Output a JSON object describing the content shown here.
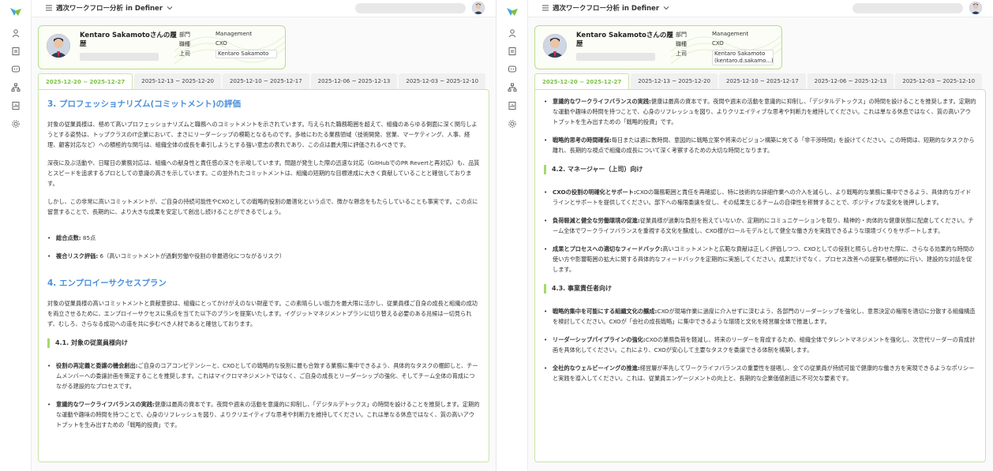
{
  "app": {
    "workflow_title": "週次ワークフロー分析 in Definer",
    "nav_icons": [
      "person-icon",
      "document-icon",
      "chat-icon",
      "org-chart-icon",
      "report-icon",
      "gear-icon"
    ]
  },
  "colors": {
    "accent": "#7cc044",
    "heading": "#4a90d9",
    "border": "#c8e6a6"
  },
  "profile": {
    "title": "Kentaro Sakamotoさんの履歴",
    "dept_label": "部門",
    "dept_value": "Management",
    "role_label": "職種",
    "role_value": "CXO",
    "boss_label": "上司",
    "boss_value_left": "Kentaro Sakamoto",
    "boss_value_right": "Kentaro Sakamoto (kentaro.d.sakamo...)"
  },
  "tabs": [
    "2025-12-20 ~ 2025-12-27",
    "2025-12-13 ~ 2025-12-20",
    "2025-12-10 ~ 2025-12-17",
    "2025-12-06 ~ 2025-12-13",
    "2025-12-03 ~ 2025-12-10"
  ],
  "left": {
    "h_professional": "3. プロフェッショナリズム(コミットメント)の評価",
    "p1": "対象の従業員様は、極めて高いプロフェッショナリズムと職務へのコミットメントを示されています。与えられた職務範囲を超えて、組織のあらゆる側面に深く関与しようとする姿勢は、トップクラスのIT企業において、まさにリーダーシップの模範となるものです。多岐にわたる業務領域（技術開発、営業、マーケティング、人事、経理、顧客対応など）への積極的な関与は、組織全体の成長を牽引しようとする強い意志の表れであり、この点は最大限に評価されるべきです。",
    "p2": "深夜に及ぶ活動や、日曜日の業務対応は、組織への献身性と責任感の深さを示唆しています。問題が発生した際の迅速な対応（GitHubでのPR Revertと再対応）も、品質とスピードを追求するプロとしての意識の高さを示しています。この並外れたコミットメントは、組織の短期的な目標達成に大きく貢献していることと確信しております。",
    "p3": "しかし、この非常に高いコミットメントが、ご自身の持続可能性やCXOとしての戦略的役割の最適化という点で、微かな懸念をもたらしていることも事実です。この点に留意することで、長期的に、より大きな成果を安定して創出し続けることができるでしょう。",
    "score_label": "総合点数:",
    "score_value": "85点",
    "risk_label": "複合リスク評価:",
    "risk_value": "6（高いコミットメントが過剰労働や役割の非最適化につながるリスク）",
    "h_plan": "4. エンプロイーサクセスプラン",
    "p4": "対象の従業員様の高いコミットメントと貢献意欲は、組織にとってかけがえのない財産です。この素晴らしい能力を最大限に活かし、従業員様ご自身の成長と組織の成功を両立させるために、エンプロイーサクセスに焦点を当てた以下のプランを提案いたします。イグジットマネジメントプランに切り替える必要のある兆候は一切見られず、むしろ、さらなる成功への道を共に歩むべき人材であると確信しております。",
    "h_41": "4.1. 対象の従業員様向け",
    "b1_label": "役割の再定義と委譲の機会創出:",
    "b1_text": "ご自身のコアコンピテンシーと、CXOとしての戦略的な役割に最も合致する業務に集中できるよう、具体的なタスクの棚卸しと、チームメンバーへの委譲計画を策定することを推奨します。これはマイクロマネジメントではなく、ご自身の成長とリーダーシップの強化、そしてチーム全体の育成につながる建設的なプロセスです。",
    "b2_label": "意識的なワークライフバランスの実践:",
    "b2_text": "健康は最高の資本です。夜間や週末の活動を意識的に抑制し、「デジタルデトックス」の時間を設けることを推奨します。定期的な運動や趣味の時間を持つことで、心身のリフレッシュを図り、よりクリエイティブな思考や判断力を維持してください。これは単なる休息ではなく、質の高いアウトプットを生み出すための「戦略的投資」です。"
  },
  "right": {
    "b1_label": "意識的なワークライフバランスの実践:",
    "b1_text": "健康は最高の資本です。夜間や週末の活動を意識的に抑制し、「デジタルデトックス」の時間を設けることを推奨します。定期的な運動や趣味の時間を持つことで、心身のリフレッシュを図り、よりクリエイティブな思考や判断力を維持してください。これは単なる休息ではなく、質の高いアウトプットを生み出すための「戦略的投資」です。",
    "b2_label": "戦略的思考の時間確保:",
    "b2_text": "毎日または週に数時間、意図的に戦略立案や将来のビジョン構築に充てる「非干渉時間」を設けてください。この時間は、短期的なタスクから離れ、長期的な視点で組織の成長について深く考察するための大切な時間となります。",
    "h_42": "4.2. マネージャー（上司）向け",
    "b3_label": "CXOの役割の明確化とサポート:",
    "b3_text": "CXOの職務範囲と責任を再確認し、特に技術的な詳細作業への介入を減らし、より戦略的な業務に集中できるよう、具体的なガイドラインとサポートを提供してください。部下への権限委譲を促し、その結果生じるチームの自律性を称賛することで、ポジティブな変化を後押しします。",
    "b4_label": "負荷軽減と健全な労働環境の促進:",
    "b4_text": "従業員様が過剰な負担を抱えていないか、定期的にコミュニケーションを取り、精神的・肉体的な健康状態に配慮してください。チーム全体でワークライフバランスを重視する文化を醸成し、CXO様がロールモデルとして健全な働き方を実践できるような環境づくりをサポートします。",
    "b5_label": "成果とプロセスへの適切なフィードバック:",
    "b5_text": "高いコミットメントと広範な貢献は正しく評価しつつ、CXOとしての役割と照らし合わせた際に、さらなる効果的な時間の使い方や影響範囲の拡大に関する具体的なフィードバックを定期的に実施してください。成果だけでなく、プロセス改善への提案も積極的に行い、建設的な対話を促します。",
    "h_43": "4.3. 事業責任者向け",
    "b6_label": "戦略的集中を可能にする組織文化の醸成:",
    "b6_text": "CXOが現場作業に過度に介入せずに済むよう、各部門のリーダーシップを強化し、意思決定の権限を適切に分散する組織構造を検討してください。CXOが「会社の成長戦略」に集中できるような環境と文化を経営層全体で推進します。",
    "b7_label": "リーダーシップパイプラインの強化:",
    "b7_text": "CXOの業務負荷を軽減し、将来のリーダーを育成するため、組織全体でタレントマネジメントを強化し、次世代リーダーの育成計画を具体化してください。これにより、CXOが安心して主要なタスクを委譲できる体制を構築します。",
    "b8_label": "全社的なウェルビーイングの推進:",
    "b8_text": "経営層が率先してワークライフバランスの重要性を提唱し、全ての従業員が持続可能で健康的な働き方を実現できるようなポリシーと実践を導入してください。これは、従業員エンゲージメントの向上と、長期的な企業価値創造に不可欠な要素です。"
  }
}
